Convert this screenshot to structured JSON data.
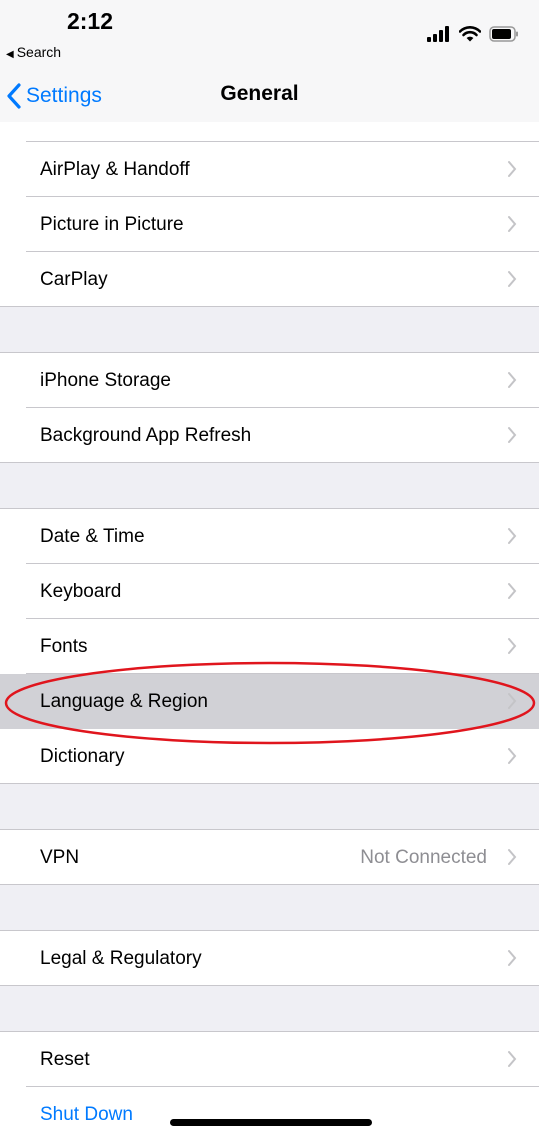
{
  "status_bar": {
    "time": "2:12",
    "back_app": "Search"
  },
  "nav": {
    "back_label": "Settings",
    "title": "General"
  },
  "groups": [
    {
      "items": [
        {
          "label": "AirPlay & Handoff"
        },
        {
          "label": "Picture in Picture"
        },
        {
          "label": "CarPlay"
        }
      ]
    },
    {
      "items": [
        {
          "label": "iPhone Storage"
        },
        {
          "label": "Background App Refresh"
        }
      ]
    },
    {
      "items": [
        {
          "label": "Date & Time"
        },
        {
          "label": "Keyboard"
        },
        {
          "label": "Fonts"
        },
        {
          "label": "Language & Region",
          "highlighted": true
        },
        {
          "label": "Dictionary"
        }
      ]
    },
    {
      "items": [
        {
          "label": "VPN",
          "value": "Not Connected"
        }
      ]
    },
    {
      "items": [
        {
          "label": "Legal & Regulatory"
        }
      ]
    },
    {
      "items": [
        {
          "label": "Reset"
        },
        {
          "label": "Shut Down",
          "style": "link"
        }
      ]
    }
  ],
  "colors": {
    "accent": "#007aff",
    "highlight_row": "#d1d1d6",
    "annotation": "#e0151d"
  }
}
